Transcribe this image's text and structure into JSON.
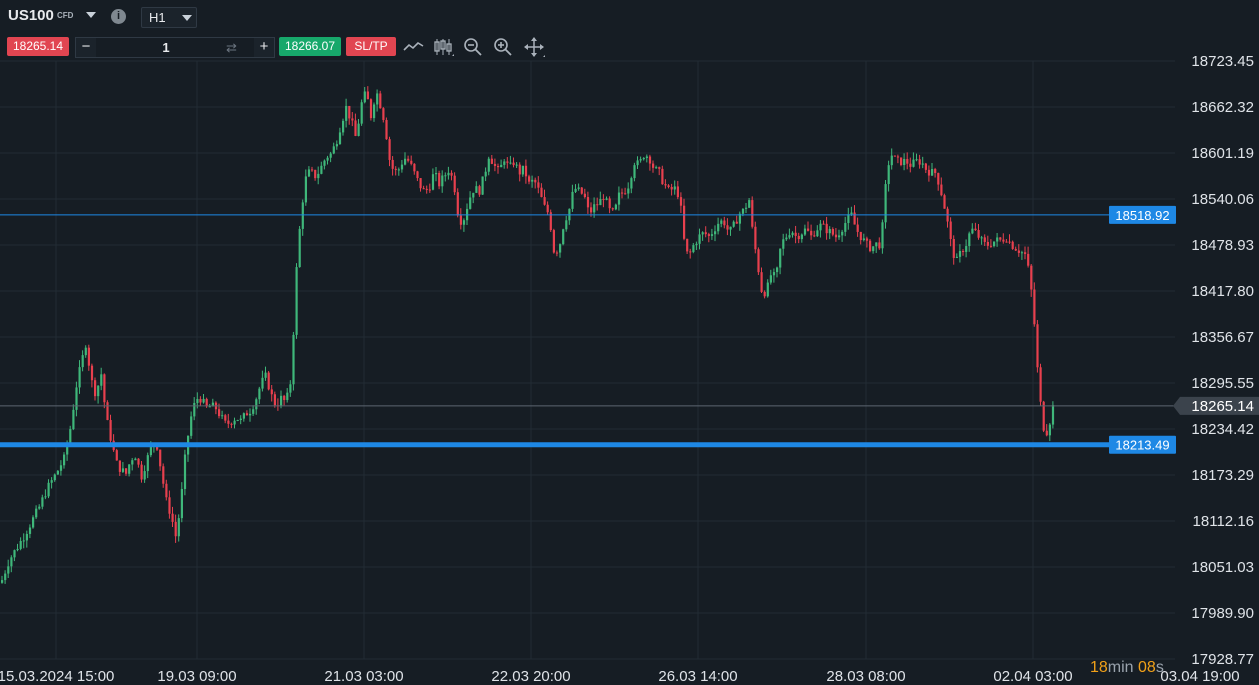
{
  "instrument": {
    "symbol": "US100",
    "type": "CFD"
  },
  "timeframe": "H1",
  "trade_panel": {
    "sell_price": "18265.14",
    "quantity": "1",
    "buy_price": "18266.07",
    "sltp_label": "SL/TP",
    "minus": "−",
    "plus": "+"
  },
  "tools": [
    "line-chart-icon",
    "candlestick-icon",
    "zoom-out-icon",
    "zoom-in-icon",
    "crosshair-icon"
  ],
  "countdown": {
    "minutes": "18",
    "min_unit": "min",
    "seconds": "08",
    "sec_unit": "s"
  },
  "colors": {
    "bull": "#3fb77a",
    "bear": "#e8404e",
    "hline": "#1e88e5",
    "bg": "#161d24"
  },
  "chart_data": {
    "type": "candlestick",
    "y_ticks": [
      "18723.45",
      "18662.32",
      "18601.19",
      "18540.06",
      "18478.93",
      "18417.80",
      "18356.67",
      "18295.55",
      "18234.42",
      "18173.29",
      "18112.16",
      "18051.03",
      "17989.90",
      "17928.77"
    ],
    "x_ticks": [
      "15.03.2024 15:00",
      "19.03 09:00",
      "21.03 03:00",
      "22.03 20:00",
      "26.03 14:00",
      "28.03 08:00",
      "02.04 03:00",
      "03.04 19:00"
    ],
    "ylim": [
      17928.77,
      18723.45
    ],
    "current_price": "18265.14",
    "horizontal_lines": [
      {
        "label": "18518.92",
        "value": 18518.92,
        "thick": false
      },
      {
        "label": "18213.49",
        "value": 18213.49,
        "thick": true
      }
    ],
    "close_path": [
      [
        0,
        18030
      ],
      [
        8,
        18060
      ],
      [
        15,
        18075
      ],
      [
        22,
        18090
      ],
      [
        30,
        18110
      ],
      [
        38,
        18130
      ],
      [
        46,
        18155
      ],
      [
        55,
        18175
      ],
      [
        63,
        18195
      ],
      [
        70,
        18240
      ],
      [
        75,
        18290
      ],
      [
        80,
        18320
      ],
      [
        85,
        18350
      ],
      [
        90,
        18300
      ],
      [
        95,
        18280
      ],
      [
        100,
        18310
      ],
      [
        105,
        18250
      ],
      [
        110,
        18220
      ],
      [
        115,
        18190
      ],
      [
        120,
        18180
      ],
      [
        125,
        18175
      ],
      [
        130,
        18195
      ],
      [
        135,
        18200
      ],
      [
        140,
        18170
      ],
      [
        145,
        18190
      ],
      [
        150,
        18210
      ],
      [
        155,
        18220
      ],
      [
        160,
        18180
      ],
      [
        165,
        18140
      ],
      [
        170,
        18120
      ],
      [
        175,
        18090
      ],
      [
        180,
        18140
      ],
      [
        185,
        18210
      ],
      [
        190,
        18250
      ],
      [
        195,
        18275
      ],
      [
        200,
        18275
      ],
      [
        205,
        18262
      ],
      [
        210,
        18265
      ],
      [
        215,
        18262
      ],
      [
        220,
        18250
      ],
      [
        225,
        18240
      ],
      [
        230,
        18245
      ],
      [
        235,
        18250
      ],
      [
        240,
        18245
      ],
      [
        245,
        18255
      ],
      [
        250,
        18260
      ],
      [
        255,
        18275
      ],
      [
        260,
        18295
      ],
      [
        265,
        18305
      ],
      [
        270,
        18280
      ],
      [
        275,
        18265
      ],
      [
        280,
        18275
      ],
      [
        285,
        18270
      ],
      [
        290,
        18300
      ],
      [
        293,
        18380
      ],
      [
        296,
        18460
      ],
      [
        300,
        18520
      ],
      [
        303,
        18555
      ],
      [
        306,
        18575
      ],
      [
        310,
        18575
      ],
      [
        315,
        18570
      ],
      [
        320,
        18582
      ],
      [
        325,
        18596
      ],
      [
        330,
        18600
      ],
      [
        335,
        18615
      ],
      [
        340,
        18640
      ],
      [
        345,
        18662
      ],
      [
        350,
        18645
      ],
      [
        355,
        18620
      ],
      [
        360,
        18665
      ],
      [
        365,
        18682
      ],
      [
        370,
        18650
      ],
      [
        375,
        18685
      ],
      [
        380,
        18662
      ],
      [
        384,
        18640
      ],
      [
        388,
        18595
      ],
      [
        393,
        18575
      ],
      [
        398,
        18580
      ],
      [
        403,
        18595
      ],
      [
        408,
        18590
      ],
      [
        413,
        18575
      ],
      [
        418,
        18560
      ],
      [
        423,
        18550
      ],
      [
        428,
        18555
      ],
      [
        433,
        18575
      ],
      [
        438,
        18560
      ],
      [
        443,
        18570
      ],
      [
        448,
        18580
      ],
      [
        453,
        18560
      ],
      [
        458,
        18510
      ],
      [
        463,
        18515
      ],
      [
        468,
        18540
      ],
      [
        473,
        18555
      ],
      [
        478,
        18550
      ],
      [
        483,
        18570
      ],
      [
        488,
        18600
      ],
      [
        493,
        18585
      ],
      [
        498,
        18575
      ],
      [
        503,
        18595
      ],
      [
        508,
        18580
      ],
      [
        513,
        18590
      ],
      [
        518,
        18575
      ],
      [
        523,
        18580
      ],
      [
        528,
        18560
      ],
      [
        533,
        18565
      ],
      [
        538,
        18550
      ],
      [
        543,
        18530
      ],
      [
        548,
        18520
      ],
      [
        553,
        18470
      ],
      [
        558,
        18475
      ],
      [
        563,
        18510
      ],
      [
        568,
        18525
      ],
      [
        573,
        18555
      ],
      [
        578,
        18550
      ],
      [
        583,
        18545
      ],
      [
        588,
        18520
      ],
      [
        593,
        18530
      ],
      [
        598,
        18535
      ],
      [
        603,
        18545
      ],
      [
        608,
        18525
      ],
      [
        613,
        18520
      ],
      [
        618,
        18545
      ],
      [
        623,
        18550
      ],
      [
        628,
        18560
      ],
      [
        633,
        18590
      ],
      [
        638,
        18585
      ],
      [
        643,
        18600
      ],
      [
        648,
        18596
      ],
      [
        653,
        18580
      ],
      [
        658,
        18575
      ],
      [
        663,
        18560
      ],
      [
        668,
        18550
      ],
      [
        673,
        18555
      ],
      [
        678,
        18545
      ],
      [
        681,
        18515
      ],
      [
        684,
        18470
      ],
      [
        688,
        18465
      ],
      [
        693,
        18480
      ],
      [
        698,
        18490
      ],
      [
        703,
        18495
      ],
      [
        708,
        18490
      ],
      [
        713,
        18500
      ],
      [
        718,
        18510
      ],
      [
        723,
        18510
      ],
      [
        728,
        18495
      ],
      [
        733,
        18505
      ],
      [
        738,
        18520
      ],
      [
        743,
        18525
      ],
      [
        748,
        18540
      ],
      [
        752,
        18490
      ],
      [
        756,
        18460
      ],
      [
        760,
        18420
      ],
      [
        765,
        18415
      ],
      [
        770,
        18440
      ],
      [
        775,
        18435
      ],
      [
        780,
        18480
      ],
      [
        785,
        18490
      ],
      [
        790,
        18500
      ],
      [
        795,
        18490
      ],
      [
        800,
        18495
      ],
      [
        805,
        18500
      ],
      [
        810,
        18490
      ],
      [
        815,
        18500
      ],
      [
        820,
        18505
      ],
      [
        825,
        18500
      ],
      [
        830,
        18495
      ],
      [
        835,
        18490
      ],
      [
        840,
        18500
      ],
      [
        845,
        18510
      ],
      [
        850,
        18520
      ],
      [
        855,
        18500
      ],
      [
        860,
        18490
      ],
      [
        865,
        18480
      ],
      [
        870,
        18475
      ],
      [
        875,
        18480
      ],
      [
        880,
        18480
      ],
      [
        883,
        18530
      ],
      [
        886,
        18580
      ],
      [
        890,
        18600
      ],
      [
        895,
        18590
      ],
      [
        900,
        18590
      ],
      [
        905,
        18590
      ],
      [
        910,
        18585
      ],
      [
        915,
        18590
      ],
      [
        920,
        18590
      ],
      [
        925,
        18580
      ],
      [
        930,
        18575
      ],
      [
        935,
        18575
      ],
      [
        940,
        18550
      ],
      [
        945,
        18520
      ],
      [
        950,
        18480
      ],
      [
        955,
        18455
      ],
      [
        960,
        18470
      ],
      [
        965,
        18480
      ],
      [
        970,
        18500
      ],
      [
        975,
        18495
      ],
      [
        980,
        18485
      ],
      [
        985,
        18478
      ],
      [
        990,
        18482
      ],
      [
        995,
        18485
      ],
      [
        1000,
        18485
      ],
      [
        1005,
        18490
      ],
      [
        1010,
        18480
      ],
      [
        1015,
        18475
      ],
      [
        1020,
        18470
      ],
      [
        1025,
        18465
      ],
      [
        1028,
        18440
      ],
      [
        1032,
        18400
      ],
      [
        1036,
        18320
      ],
      [
        1040,
        18260
      ],
      [
        1044,
        18225
      ],
      [
        1048,
        18240
      ],
      [
        1052,
        18265
      ]
    ]
  }
}
